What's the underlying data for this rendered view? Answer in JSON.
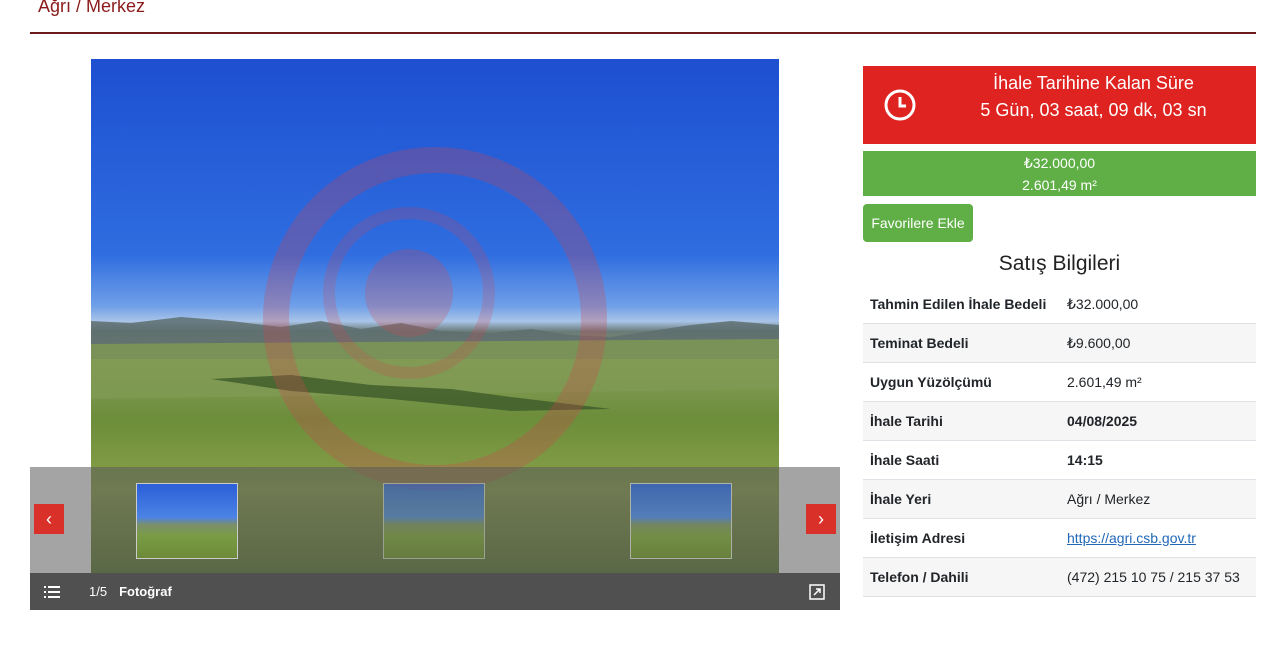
{
  "header": {
    "location": "Ağrı / Merkez"
  },
  "gallery": {
    "counter": "1/5",
    "label": "Fotoğraf",
    "thumbnails": [
      "thumb-1",
      "thumb-2",
      "thumb-3"
    ],
    "icons": {
      "prev": "chevron-left-icon",
      "next": "chevron-right-icon",
      "list": "list-icon",
      "expand": "expand-icon"
    }
  },
  "countdown": {
    "title": "İhale Tarihine Kalan Süre",
    "value": "5 Gün, 03 saat, 09 dk, 03 sn",
    "icon": "clock-icon",
    "color": "#de2320"
  },
  "price": {
    "amount": "₺32.000,00",
    "area": "2.601,49 m²",
    "color": "#5faf46"
  },
  "favorite_button": "Favorilere Ekle",
  "section_title": "Satış Bilgileri",
  "details": [
    {
      "key": "Tahmin Edilen İhale Bedeli",
      "value": "₺32.000,00"
    },
    {
      "key": "Teminat Bedeli",
      "value": "₺9.600,00"
    },
    {
      "key": "Uygun Yüzölçümü",
      "value": "2.601,49 m²"
    },
    {
      "key": "İhale Tarihi",
      "value": "04/08/2025"
    },
    {
      "key": "İhale Saati",
      "value": "14:15"
    },
    {
      "key": "İhale Yeri",
      "value": "Ağrı / Merkez"
    },
    {
      "key": "İletişim Adresi",
      "value": "https://agri.csb.gov.tr"
    },
    {
      "key": "Telefon / Dahili",
      "value": "(472) 215 10 75 / 215 37 53"
    }
  ]
}
